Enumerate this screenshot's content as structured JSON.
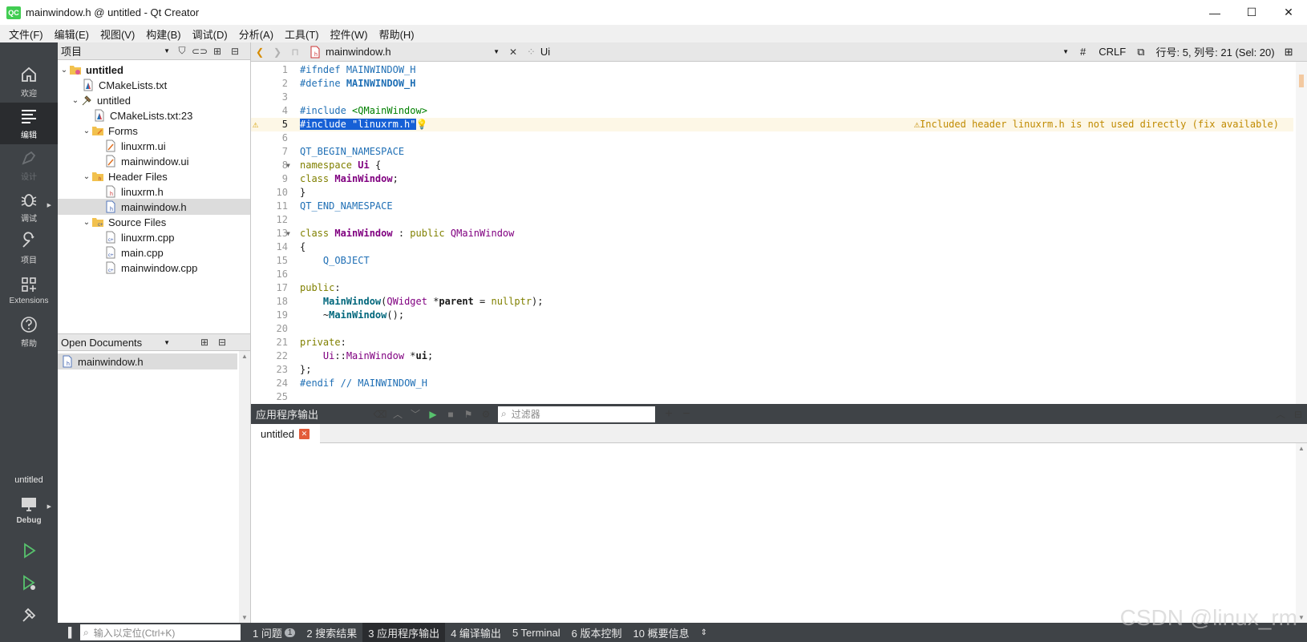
{
  "window": {
    "title": "mainwindow.h @ untitled - Qt Creator",
    "logo": "QC",
    "minimize": "—",
    "maximize": "☐",
    "close": "✕"
  },
  "menu": [
    "文件(F)",
    "编辑(E)",
    "视图(V)",
    "构建(B)",
    "调试(D)",
    "分析(A)",
    "工具(T)",
    "控件(W)",
    "帮助(H)"
  ],
  "modes": {
    "welcome": "欢迎",
    "edit": "编辑",
    "design": "设计",
    "debug": "调试",
    "projects": "项目",
    "extensions": "Extensions",
    "help": "帮助",
    "kit_project": "untitled",
    "kit_build": "Debug"
  },
  "project_panel": {
    "combo": "项目",
    "tree": [
      {
        "label": "untitled",
        "bold": true
      },
      {
        "label": "CMakeLists.txt"
      },
      {
        "label": "untitled"
      },
      {
        "label": "CMakeLists.txt:23"
      },
      {
        "label": "Forms"
      },
      {
        "label": "linuxrm.ui"
      },
      {
        "label": "mainwindow.ui"
      },
      {
        "label": "Header Files"
      },
      {
        "label": "linuxrm.h"
      },
      {
        "label": "mainwindow.h"
      },
      {
        "label": "Source Files"
      },
      {
        "label": "linuxrm.cpp"
      },
      {
        "label": "main.cpp"
      },
      {
        "label": "mainwindow.cpp"
      }
    ]
  },
  "open_documents": {
    "title": "Open Documents",
    "items": [
      "mainwindow.h"
    ]
  },
  "editor_toolbar": {
    "file": "mainwindow.h",
    "symbol": "Ui",
    "hash": "#",
    "line_ending": "CRLF",
    "position": "行号: 5, 列号: 21 (Sel: 20)"
  },
  "code": {
    "line_numbers": [
      "1",
      "2",
      "3",
      "4",
      "5",
      "6",
      "7",
      "8",
      "9",
      "10",
      "11",
      "12",
      "13",
      "14",
      "15",
      "16",
      "17",
      "18",
      "19",
      "20",
      "21",
      "22",
      "23",
      "24",
      "25"
    ],
    "warning": "Included header linuxrm.h is not used directly (fix available)"
  },
  "output": {
    "title": "应用程序输出",
    "filter_placeholder": "过滤器",
    "tab": "untitled",
    "tab_close": "✕"
  },
  "statusbar": {
    "locator_placeholder": "输入以定位(Ctrl+K)",
    "tabs": [
      "1 问题",
      "2 搜索结果",
      "3 应用程序输出",
      "4 编译输出",
      "5 Terminal",
      "6 版本控制",
      "10 概要信息"
    ],
    "problem_count": "1"
  },
  "watermark": "CSDN @linux_rm"
}
